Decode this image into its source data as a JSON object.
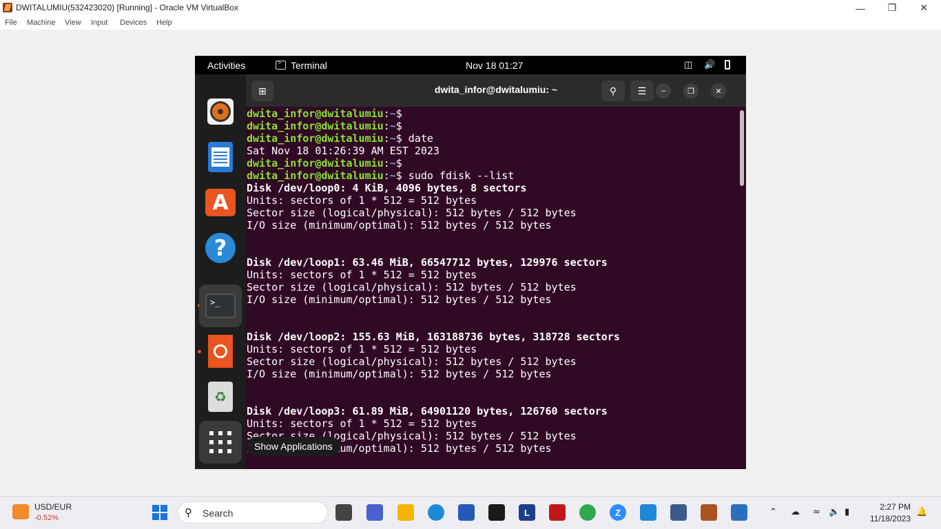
{
  "vbox": {
    "title": "DWITALUMIU(532423020) [Running] - Oracle VM VirtualBox",
    "menu": [
      "File",
      "Machine",
      "View",
      "Input",
      "Devices",
      "Help"
    ]
  },
  "ubuntu": {
    "activities": "Activities",
    "app_name": "Terminal",
    "clock": "Nov 18  01:27"
  },
  "terminal": {
    "title": "dwita_infor@dwitalumiu: ~",
    "tooltip": "Show Applications",
    "prompt_user": "dwita_infor@dwitalumiu",
    "prompt_sep": ":",
    "prompt_path": "~",
    "prompt_end": "$",
    "lines": [
      {
        "type": "prompt",
        "cmd": ""
      },
      {
        "type": "prompt",
        "cmd": ""
      },
      {
        "type": "prompt",
        "cmd": " date"
      },
      {
        "type": "out",
        "text": "Sat Nov 18 01:26:39 AM EST 2023"
      },
      {
        "type": "prompt",
        "cmd": ""
      },
      {
        "type": "prompt",
        "cmd": " sudo fdisk --list"
      },
      {
        "type": "bold",
        "text": "Disk /dev/loop0: 4 KiB, 4096 bytes, 8 sectors"
      },
      {
        "type": "out",
        "text": "Units: sectors of 1 * 512 = 512 bytes"
      },
      {
        "type": "out",
        "text": "Sector size (logical/physical): 512 bytes / 512 bytes"
      },
      {
        "type": "out",
        "text": "I/O size (minimum/optimal): 512 bytes / 512 bytes"
      },
      {
        "type": "out",
        "text": ""
      },
      {
        "type": "out",
        "text": ""
      },
      {
        "type": "bold",
        "text": "Disk /dev/loop1: 63.46 MiB, 66547712 bytes, 129976 sectors"
      },
      {
        "type": "out",
        "text": "Units: sectors of 1 * 512 = 512 bytes"
      },
      {
        "type": "out",
        "text": "Sector size (logical/physical): 512 bytes / 512 bytes"
      },
      {
        "type": "out",
        "text": "I/O size (minimum/optimal): 512 bytes / 512 bytes"
      },
      {
        "type": "out",
        "text": ""
      },
      {
        "type": "out",
        "text": ""
      },
      {
        "type": "bold",
        "text": "Disk /dev/loop2: 155.63 MiB, 163188736 bytes, 318728 sectors"
      },
      {
        "type": "out",
        "text": "Units: sectors of 1 * 512 = 512 bytes"
      },
      {
        "type": "out",
        "text": "Sector size (logical/physical): 512 bytes / 512 bytes"
      },
      {
        "type": "out",
        "text": "I/O size (minimum/optimal): 512 bytes / 512 bytes"
      },
      {
        "type": "out",
        "text": ""
      },
      {
        "type": "out",
        "text": ""
      },
      {
        "type": "bold",
        "text": "Disk /dev/loop3: 61.89 MiB, 64901120 bytes, 126760 sectors"
      },
      {
        "type": "out",
        "text": "Units: sectors of 1 * 512 = 512 bytes"
      },
      {
        "type": "out",
        "text": "Sector size (logical/physical): 512 bytes / 512 bytes"
      },
      {
        "type": "out",
        "text": "I/O size (minimum/optimal): 512 bytes / 512 bytes"
      }
    ]
  },
  "taskbar": {
    "widget_title": "USD/EUR",
    "widget_change": "-0.52%",
    "search_placeholder": "Search",
    "time": "2:27 PM",
    "date": "11/18/2023"
  },
  "colors": {
    "terminal_bg": "#300a24",
    "prompt_green": "#8ae234",
    "path_blue": "#729fcf",
    "ubuntu_orange": "#e95420"
  }
}
